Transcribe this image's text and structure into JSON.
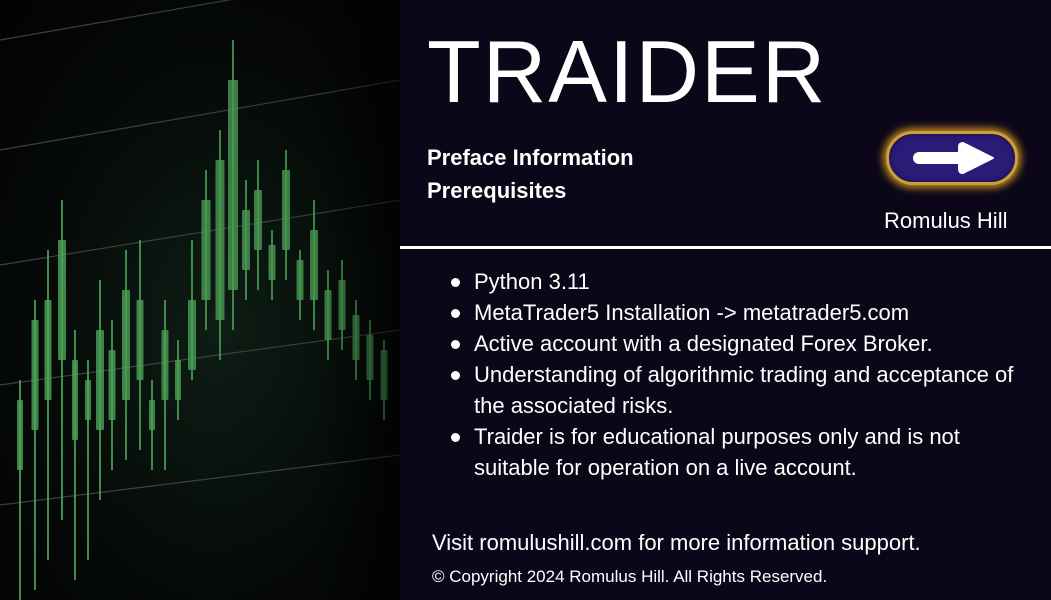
{
  "header": {
    "title": "TRAIDER",
    "subheadings": [
      "Preface Information",
      "Prerequisites"
    ],
    "next_button_icon": "arrow-right-icon",
    "author": "Romulus Hill"
  },
  "prerequisites": [
    "Python 3.11",
    "MetaTrader5 Installation -> metatrader5.com",
    "Active account with a designated Forex Broker.",
    "Understanding of algorithmic trading and acceptance of the associated risks.",
    "Traider is for educational purposes only and is not suitable for operation on a live account."
  ],
  "footer": {
    "visit": "Visit romulushill.com for more information support.",
    "copyright": "© Copyright 2024 Romulus Hill. All Rights Reserved."
  },
  "colors": {
    "background": "#0b0718",
    "button": "#2b1a77",
    "button_glow": "#e6a028",
    "chart_green": "#4fa65a"
  }
}
